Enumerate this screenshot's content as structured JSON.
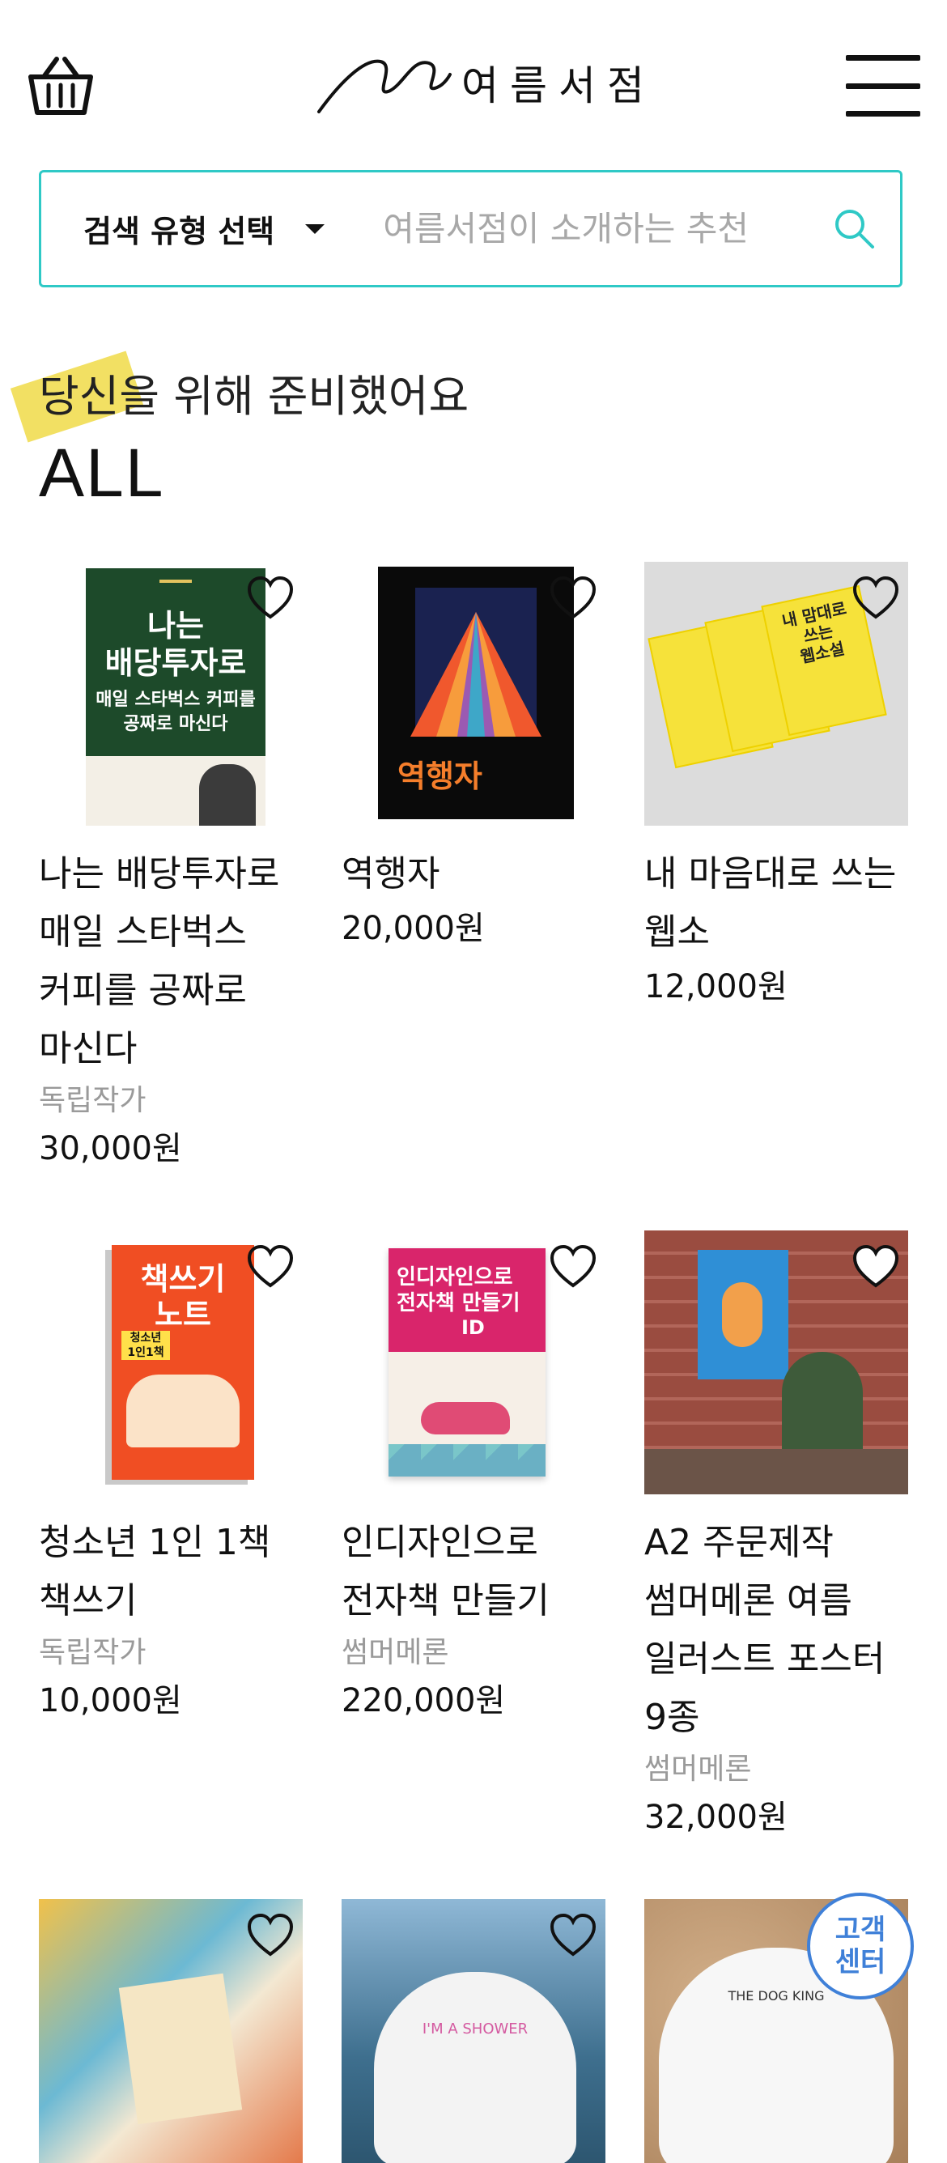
{
  "header": {
    "logo_text": "여름서점",
    "basket_icon": "basket-icon",
    "menu_icon": "hamburger-menu-icon"
  },
  "search": {
    "type_label": "검색 유형 선택",
    "placeholder": "여름서점이 소개하는 추천",
    "accent": "#2fc9c6"
  },
  "section": {
    "subtitle": "당신을 위해 준비했어요",
    "title": "ALL"
  },
  "products": [
    {
      "name": "나는 배당투자로 매일 스타벅스 커피를 공짜로 마신다",
      "seller": "독립작가",
      "price": "30,000원",
      "cover": "dividend-book-cover"
    },
    {
      "name": "역행자",
      "seller": "",
      "price": "20,000원",
      "cover": "reverse-book-cover"
    },
    {
      "name": "내 마음대로 쓰는 웹소",
      "seller": "",
      "price": "12,000원",
      "cover": "web-novel-book-cover"
    },
    {
      "name": "청소년 1인 1책 책쓰기",
      "seller": "독립작가",
      "price": "10,000원",
      "cover": "writing-note-book-cover"
    },
    {
      "name": "인디자인으로 전자책 만들기",
      "seller": "썸머메론",
      "price": "220,000원",
      "cover": "indesign-book-cover"
    },
    {
      "name": "A2 주문제작 썸머메론 여름 일러스트 포스터 9종",
      "seller": "썸머메론",
      "price": "32,000원",
      "cover": "summer-poster-photo"
    },
    {
      "name": "",
      "seller": "",
      "price": "",
      "cover": "illustration-photo"
    },
    {
      "name": "",
      "seller": "",
      "price": "",
      "cover": "swim-cap-sea-photo"
    },
    {
      "name": "",
      "seller": "",
      "price": "",
      "cover": "swim-cap-sand-photo"
    }
  ],
  "cover_texts": {
    "dividend_title": "나는\n배당투자로",
    "dividend_sub": "매일 스타벅스 커피를\n공짜로 마신다",
    "reverse_title": "역행자",
    "webnovel_title": "내 맘대로\n쓰는\n웹소설",
    "note_title": "책쓰기\n노트",
    "note_badge": "청소년\n1인1책",
    "indesign_title": "인디자인으로\n전자책 만들기",
    "indesign_id": "ID",
    "poster_caption": "",
    "swim_text": "I'M A SHOWER",
    "dog_text": "THE DOG KING"
  },
  "chat_button": {
    "label": "고객\n센터",
    "color": "#3f80d8"
  }
}
